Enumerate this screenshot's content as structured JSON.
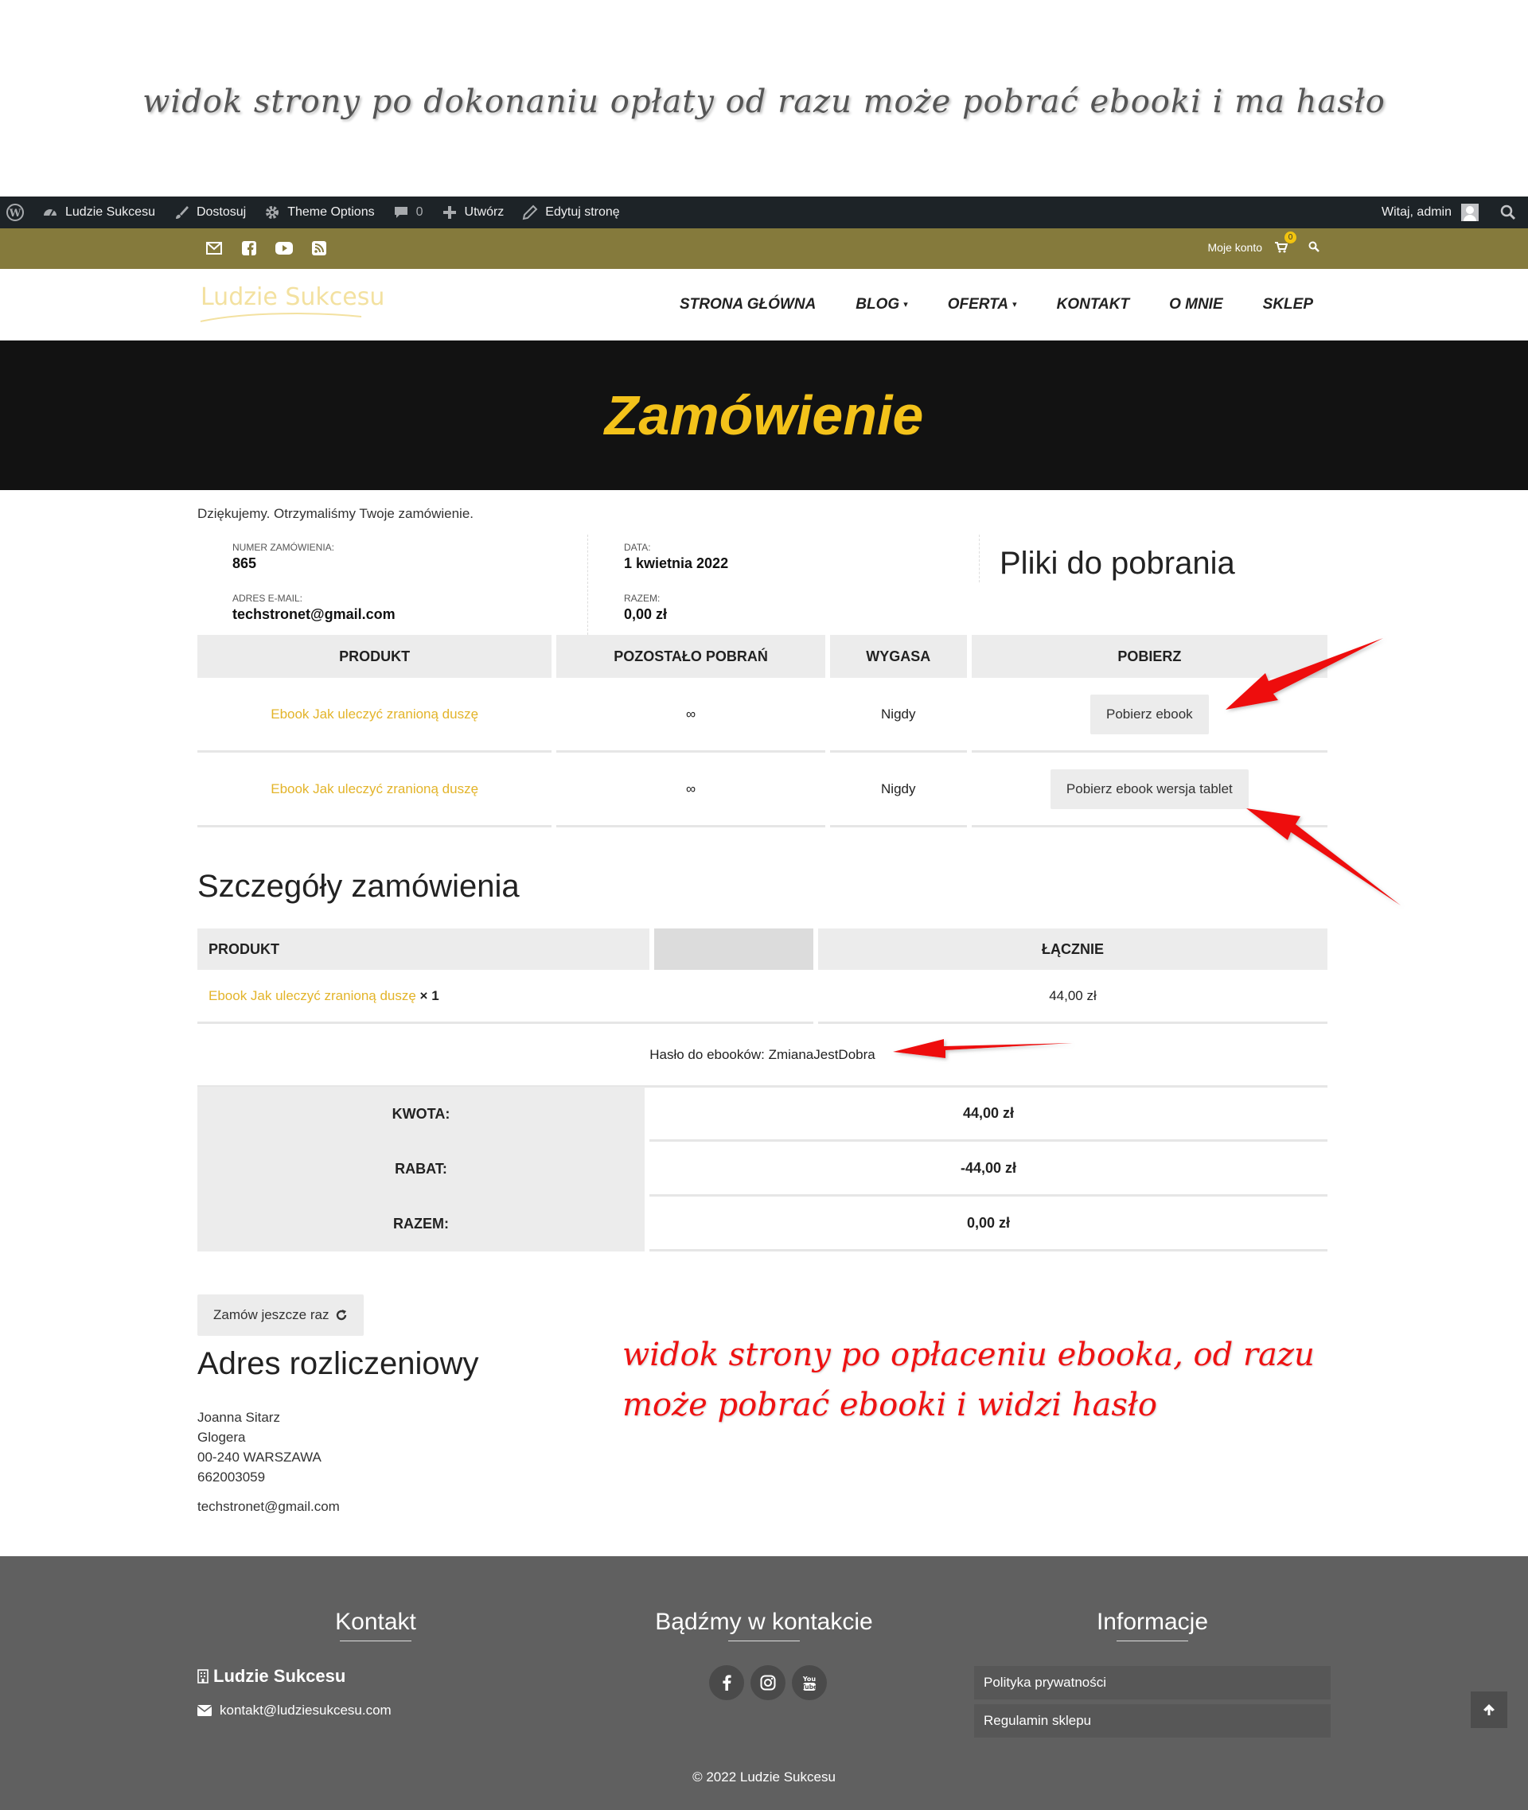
{
  "annotations": {
    "top_note": "widok strony po dokonaniu opłaty od razu może pobrać ebooki i ma hasło",
    "red_note_line1": "widok strony po opłaceniu ebooka, od razu",
    "red_note_line2": "może pobrać ebooki i widzi hasło"
  },
  "adminbar": {
    "site": "Ludzie Sukcesu",
    "customize": "Dostosuj",
    "theme_options": "Theme Options",
    "comments": "0",
    "new": "Utwórz",
    "edit": "Edytuj stronę",
    "greeting": "Witaj, admin"
  },
  "topbar": {
    "account": "Moje konto",
    "cart_count": "0"
  },
  "header": {
    "logo": "Ludzie Sukcesu",
    "nav": {
      "home": "STRONA GŁÓWNA",
      "blog": "BLOG",
      "offer": "OFERTA",
      "contact": "KONTAKT",
      "about": "O MNIE",
      "shop": "SKLEP"
    }
  },
  "page": {
    "title": "Zamówienie",
    "thanks": "Dziękujemy. Otrzymaliśmy Twoje zamówienie.",
    "meta": {
      "order_label": "NUMER ZAMÓWIENIA:",
      "order_value": "865",
      "date_label": "DATA:",
      "date_value": "1 kwietnia 2022",
      "email_label": "ADRES E-MAIL:",
      "email_value": "techstronet@gmail.com",
      "total_label": "RAZEM:",
      "total_value": "0,00 zł"
    }
  },
  "downloads": {
    "heading": "Pliki do pobrania",
    "columns": [
      "PRODUKT",
      "POZOSTAŁO POBRAŃ",
      "WYGASA",
      "POBIERZ"
    ],
    "rows": [
      {
        "product": "Ebook Jak uleczyć zranioną duszę",
        "remaining": "∞",
        "expires": "Nigdy",
        "button": "Pobierz ebook"
      },
      {
        "product": "Ebook Jak uleczyć zranioną duszę",
        "remaining": "∞",
        "expires": "Nigdy",
        "button": "Pobierz ebook wersja tablet"
      }
    ]
  },
  "order_details": {
    "heading": "Szczegóły zamówienia",
    "col_product": "PRODUKT",
    "col_total": "ŁĄCZNIE",
    "item_name": "Ebook Jak uleczyć zranioną duszę",
    "item_qty": "× 1",
    "item_total": "44,00 zł",
    "password_note": "Hasło do ebooków: ZmianaJestDobra",
    "summary": [
      {
        "label": "KWOTA:",
        "value": "44,00 zł"
      },
      {
        "label": "RABAT:",
        "value": "-44,00 zł"
      },
      {
        "label": "RAZEM:",
        "value": "0,00 zł"
      }
    ],
    "order_again": "Zamów jeszcze raz"
  },
  "billing": {
    "heading": "Adres rozliczeniowy",
    "name": "Joanna Sitarz",
    "street": "Glogera",
    "city": "00-240 WARSZAWA",
    "phone": "662003059",
    "email": "techstronet@gmail.com"
  },
  "footer": {
    "contact_heading": "Kontakt",
    "social_heading": "Bądźmy w kontakcie",
    "info_heading": "Informacje",
    "brand": "Ludzie Sukcesu",
    "email": "kontakt@ludziesukcesu.com",
    "links": [
      "Polityka prywatności",
      "Regulamin sklepu"
    ],
    "copyright": "© 2022 Ludzie Sukcesu"
  },
  "colors": {
    "accent": "#f3c21a",
    "olive": "#857a3c",
    "footer": "#606060",
    "annotation_red": "#e11111"
  }
}
